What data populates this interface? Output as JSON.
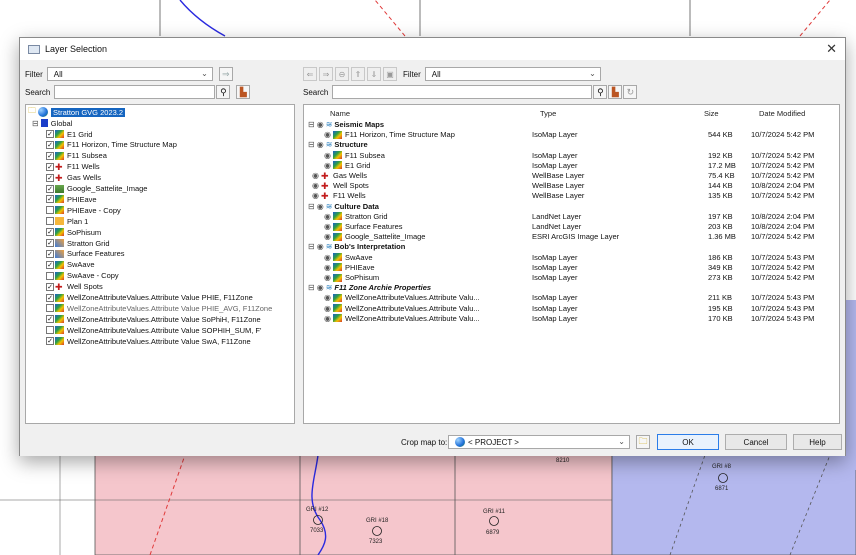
{
  "map": {
    "wells": [
      {
        "name": "GRI #12",
        "value": "7033"
      },
      {
        "name": "GRI #18",
        "value": "7323"
      },
      {
        "name": "GRI #11",
        "value": "6879"
      },
      {
        "name": "GRI #8",
        "value": "6871"
      }
    ],
    "contour_label": "8210",
    "colors": {
      "pink": "#f5c6cc",
      "blue": "#b4b8ee",
      "fault": "#e03a3a"
    }
  },
  "dialog": {
    "title": "Layer Selection",
    "close_glyph": "✕"
  },
  "left": {
    "filter_label": "Filter",
    "filter_value": "All",
    "search_label": "Search",
    "search_value": "",
    "tree": {
      "root": "Stratton GVG 2023.2",
      "global": "Global",
      "items": [
        {
          "label": "E1 Grid",
          "checked": true,
          "icon": "map-icon"
        },
        {
          "label": "F11 Horizon, Time Structure Map",
          "checked": true,
          "icon": "map-icon"
        },
        {
          "label": "F11 Subsea",
          "checked": true,
          "icon": "map-icon"
        },
        {
          "label": "F11 Wells",
          "checked": true,
          "icon": "well-icon"
        },
        {
          "label": "Gas Wells",
          "checked": true,
          "icon": "well-icon"
        },
        {
          "label": "Google_Sattelite_Image",
          "checked": true,
          "icon": "image-icon"
        },
        {
          "label": "PHIEave",
          "checked": true,
          "icon": "map-icon"
        },
        {
          "label": "PHIEave - Copy",
          "checked": false,
          "icon": "map-icon"
        },
        {
          "label": "Plan 1",
          "checked": false,
          "icon": "plan-icon"
        },
        {
          "label": "SoPhisum",
          "checked": true,
          "icon": "map-icon"
        },
        {
          "label": "Stratton Grid",
          "checked": true,
          "icon": "grid-icon"
        },
        {
          "label": "Surface Features",
          "checked": true,
          "icon": "grid-icon"
        },
        {
          "label": "SwAave",
          "checked": true,
          "icon": "map-icon"
        },
        {
          "label": "SwAave - Copy",
          "checked": false,
          "icon": "map-icon"
        },
        {
          "label": "Well Spots",
          "checked": true,
          "icon": "well-icon"
        },
        {
          "label": "WellZoneAttributeValues.Attribute Value PHIE, F11Zone",
          "checked": true,
          "icon": "map-icon"
        },
        {
          "label": "WellZoneAttributeValues.Attribute Value PHIE_AVG, F11Zone",
          "checked": false,
          "icon": "map-icon"
        },
        {
          "label": "WellZoneAttributeValues.Attribute Value SoPhiH, F11Zone",
          "checked": true,
          "icon": "map-icon"
        },
        {
          "label": "WellZoneAttributeValues.Attribute Value SOPHIH_SUM, F'",
          "checked": false,
          "icon": "map-icon"
        },
        {
          "label": "WellZoneAttributeValues.Attribute Value SwA, F11Zone",
          "checked": true,
          "icon": "map-icon"
        }
      ]
    }
  },
  "right": {
    "filter_label": "Filter",
    "filter_value": "All",
    "search_label": "Search",
    "search_value": "",
    "columns": {
      "name": "Name",
      "type": "Type",
      "size": "Size",
      "date": "Date Modified"
    },
    "groups": [
      {
        "name": "Seismic Maps",
        "rows": [
          {
            "name": "F11 Horizon, Time Structure Map",
            "type": "IsoMap Layer",
            "size": "544 KB",
            "date": "10/7/2024 5:42 PM"
          }
        ]
      },
      {
        "name": "Structure",
        "rows": [
          {
            "name": "F11 Subsea",
            "type": "IsoMap Layer",
            "size": "192 KB",
            "date": "10/7/2024 5:42 PM"
          },
          {
            "name": "E1 Grid",
            "type": "IsoMap Layer",
            "size": "17.2 MB",
            "date": "10/7/2024 5:42 PM"
          }
        ]
      },
      {
        "name": "",
        "rows": [
          {
            "name": "Gas Wells",
            "type": "WellBase Layer",
            "size": "75.4 KB",
            "date": "10/7/2024 5:42 PM"
          },
          {
            "name": "Well Spots",
            "type": "WellBase Layer",
            "size": "144 KB",
            "date": "10/8/2024 2:04 PM"
          },
          {
            "name": "F11 Wells",
            "type": "WellBase Layer",
            "size": "135 KB",
            "date": "10/7/2024 5:42 PM"
          }
        ]
      },
      {
        "name": "Culture Data",
        "rows": [
          {
            "name": "Stratton Grid",
            "type": "LandNet Layer",
            "size": "197 KB",
            "date": "10/8/2024 2:04 PM"
          },
          {
            "name": "Surface Features",
            "type": "LandNet Layer",
            "size": "203 KB",
            "date": "10/8/2024 2:04 PM"
          },
          {
            "name": "Google_Sattelite_Image",
            "type": "ESRI ArcGIS Image Layer",
            "size": "1.36 MB",
            "date": "10/7/2024 5:42 PM"
          }
        ]
      },
      {
        "name": "Bob's Interpretation",
        "rows": [
          {
            "name": "SwAave",
            "type": "IsoMap Layer",
            "size": "186 KB",
            "date": "10/7/2024 5:43 PM"
          },
          {
            "name": "PHIEave",
            "type": "IsoMap Layer",
            "size": "349 KB",
            "date": "10/7/2024 5:42 PM"
          },
          {
            "name": "SoPhisum",
            "type": "IsoMap Layer",
            "size": "273 KB",
            "date": "10/7/2024 5:42 PM"
          }
        ]
      },
      {
        "name": "F11 Zone Archie Properties",
        "rows": [
          {
            "name": "WellZoneAttributeValues.Attribute Valu...",
            "type": "IsoMap Layer",
            "size": "211 KB",
            "date": "10/7/2024 5:43 PM"
          },
          {
            "name": "WellZoneAttributeValues.Attribute Valu...",
            "type": "IsoMap Layer",
            "size": "195 KB",
            "date": "10/7/2024 5:43 PM"
          },
          {
            "name": "WellZoneAttributeValues.Attribute Valu...",
            "type": "IsoMap Layer",
            "size": "170 KB",
            "date": "10/7/2024 5:43 PM"
          }
        ]
      }
    ]
  },
  "bottom": {
    "crop_label": "Crop map to:",
    "crop_value": "< PROJECT >",
    "ok": "OK",
    "cancel": "Cancel",
    "help": "Help"
  }
}
